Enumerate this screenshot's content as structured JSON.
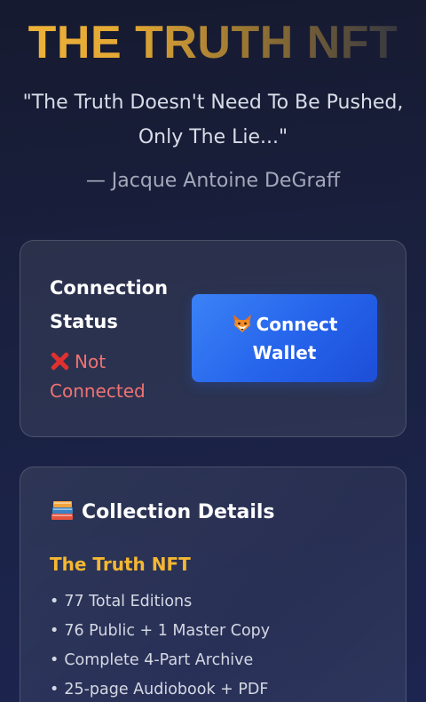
{
  "hero": {
    "title": "THE TRUTH NFT",
    "quote": "\"The Truth Doesn't Need To Be Pushed, Only The Lie...\"",
    "author": "— Jacque Antoine DeGraff"
  },
  "connection": {
    "heading": "Connection Status",
    "status_icon": "cross-mark-icon",
    "status_text": "Not Connected",
    "button_icon": "fox-icon",
    "button_label": "Connect Wallet"
  },
  "collection": {
    "heading_icon": "books-icon",
    "heading": "Collection Details",
    "name": "The Truth NFT",
    "bullet": "•",
    "features": [
      "77 Total Editions",
      "76 Public + 1 Master Copy",
      "Complete 4-Part Archive",
      "25-page Audiobook + PDF"
    ]
  },
  "colors": {
    "accent_gold": "#f5b731",
    "button_blue": "#2563eb",
    "status_red": "#f07272",
    "background": "#1a2140"
  }
}
